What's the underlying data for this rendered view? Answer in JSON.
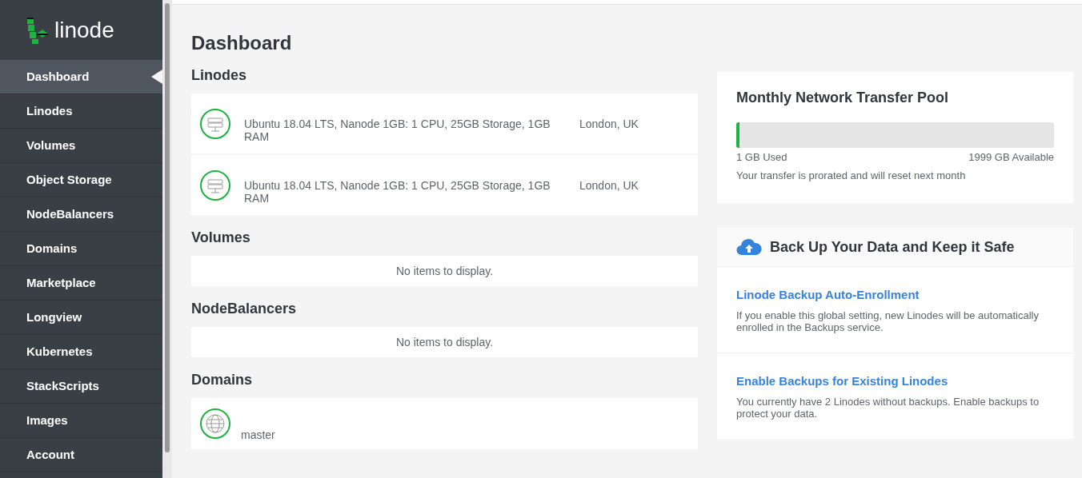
{
  "sidebar": {
    "logo": "linode",
    "items": [
      {
        "label": "Dashboard",
        "selected": true
      },
      {
        "label": "Linodes",
        "selected": false
      },
      {
        "label": "Volumes",
        "selected": false
      },
      {
        "label": "Object Storage",
        "selected": false
      },
      {
        "label": "NodeBalancers",
        "selected": false
      },
      {
        "label": "Domains",
        "selected": false
      },
      {
        "label": "Marketplace",
        "selected": false
      },
      {
        "label": "Longview",
        "selected": false
      },
      {
        "label": "Kubernetes",
        "selected": false
      },
      {
        "label": "StackScripts",
        "selected": false
      },
      {
        "label": "Images",
        "selected": false
      },
      {
        "label": "Account",
        "selected": false
      }
    ]
  },
  "page_title": "Dashboard",
  "sections": [
    {
      "title": "Linodes",
      "kind": "linodes",
      "rows": [
        {
          "description": "Ubuntu 18.04 LTS, Nanode 1GB: 1 CPU, 25GB Storage, 1GB RAM",
          "region": "London, UK"
        },
        {
          "description": "Ubuntu 18.04 LTS, Nanode 1GB: 1 CPU, 25GB Storage, 1GB RAM",
          "region": "London, UK"
        }
      ]
    },
    {
      "title": "Volumes",
      "kind": "empty",
      "message": "No items to display."
    },
    {
      "title": "NodeBalancers",
      "kind": "empty",
      "message": "No items to display."
    },
    {
      "title": "Domains",
      "kind": "domains",
      "rows": [
        {
          "name": "master"
        }
      ]
    }
  ],
  "transfer": {
    "title": "Monthly Network Transfer Pool",
    "level": 0.01,
    "used": "1 GB Used",
    "available": "1999 GB Available",
    "note": "Your transfer is prorated and will reset next month"
  },
  "backups": {
    "title": "Back Up Your Data and Keep it Safe",
    "items": [
      {
        "link": "Linode Backup Auto-Enrollment",
        "text": "If you enable this global setting, new Linodes will be automatically enrolled in the Backups service."
      },
      {
        "link": "Enable Backups for Existing Linodes",
        "text": "You currently have 2 Linodes without backups. Enable backups to protect your data."
      }
    ]
  }
}
